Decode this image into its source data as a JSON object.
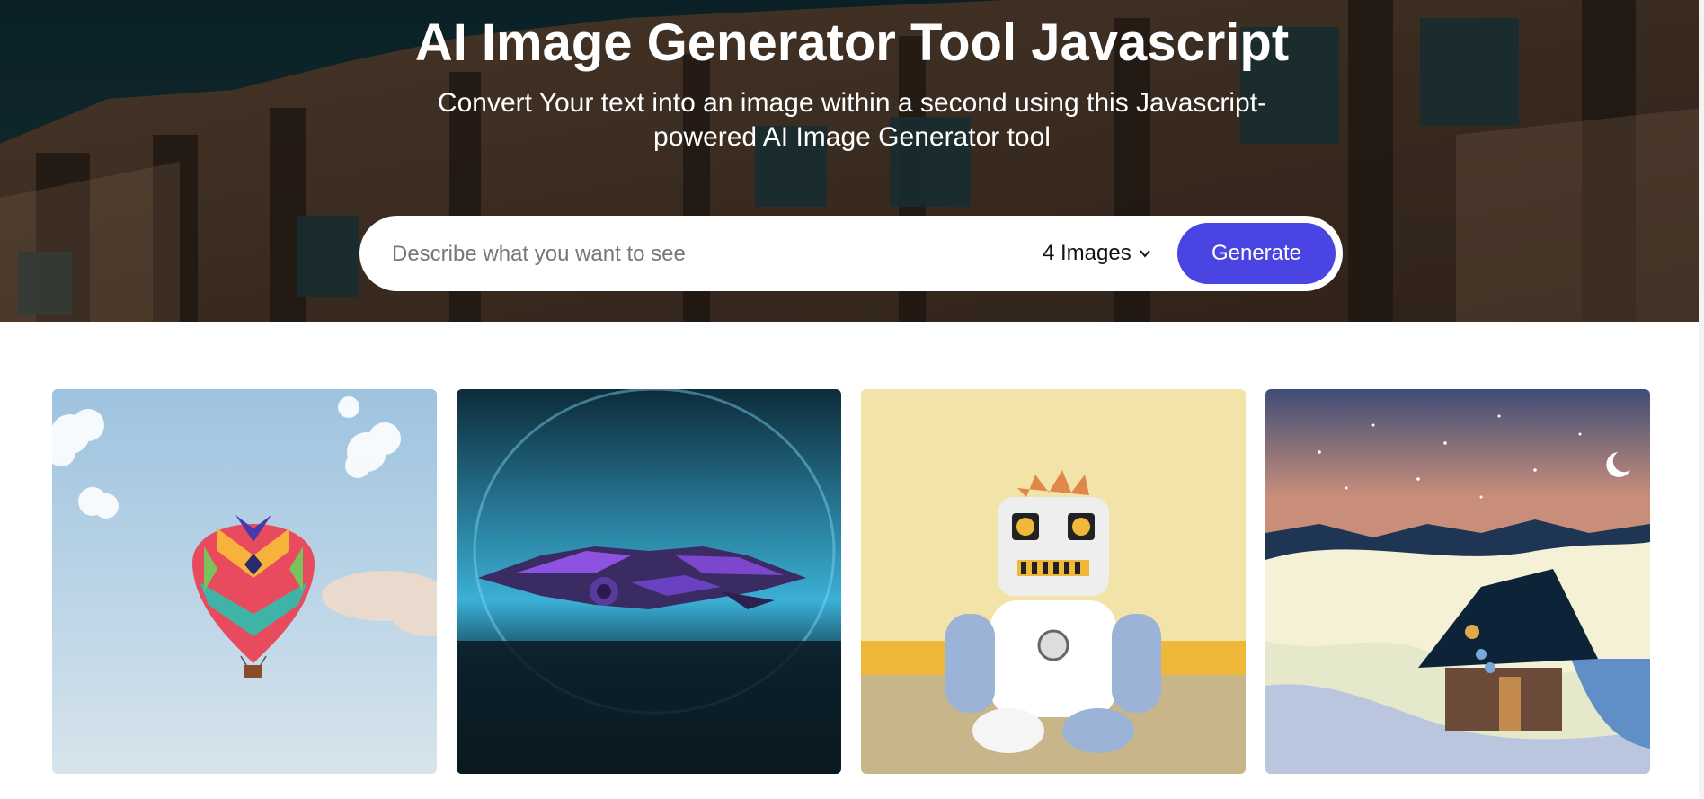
{
  "hero": {
    "title": "AI Image Generator Tool Javascript",
    "subtitle": "Convert Your text into an image within a second using this Javascript-powered AI Image Generator tool"
  },
  "search": {
    "placeholder": "Describe what you want to see",
    "value": "",
    "image_count_selected": "4 Images",
    "generate_label": "Generate"
  },
  "gallery": {
    "images": [
      {
        "subject": "hot air balloon in sky"
      },
      {
        "subject": "purple futuristic spaceship"
      },
      {
        "subject": "plush robot toy"
      },
      {
        "subject": "snowy landscape with cabin at night"
      }
    ]
  },
  "colors": {
    "accent": "#4a45e2",
    "hero_overlay": "#1c2e30"
  }
}
